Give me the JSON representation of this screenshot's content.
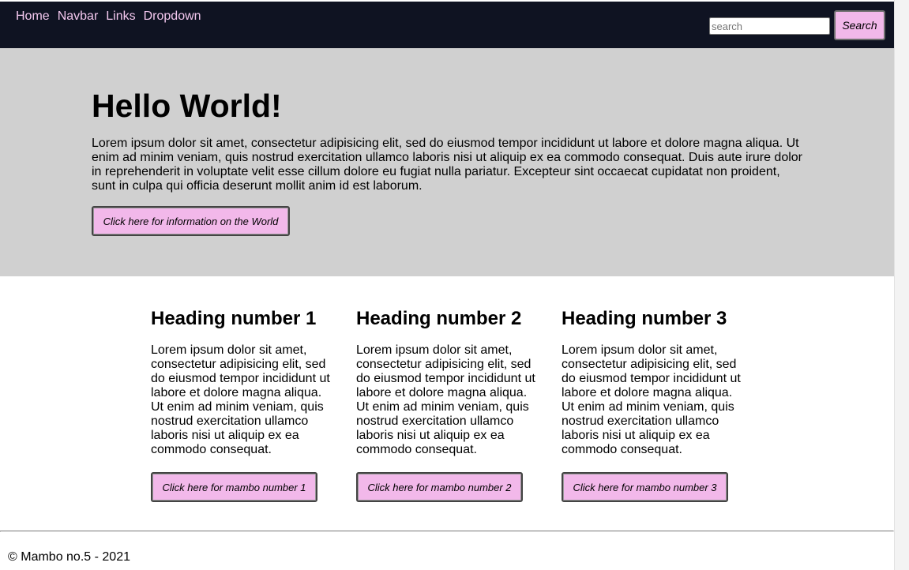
{
  "navbar": {
    "links": [
      "Home",
      "Navbar",
      "Links",
      "Dropdown"
    ],
    "search_placeholder": "search",
    "search_button": "Search",
    "background": "#0f1322",
    "link_color": "#f4c8ef"
  },
  "hero": {
    "title": "Hello World!",
    "text": "Lorem ipsum dolor sit amet, consectetur adipisicing elit, sed do eiusmod tempor incididunt ut labore et dolore magna aliqua. Ut enim ad minim veniam, quis nostrud exercitation ullamco laboris nisi ut aliquip ex ea commodo consequat. Duis aute irure dolor in reprehenderit in voluptate velit esse cillum dolore eu fugiat nulla pariatur. Excepteur sint occaecat cupidatat non proident, sunt in culpa qui officia deserunt mollit anim id est laborum.",
    "button": "Click here for information on the World",
    "background": "#d0d0d0"
  },
  "columns": [
    {
      "heading": "Heading number 1",
      "text": "Lorem ipsum dolor sit amet, consectetur adipisicing elit, sed do eiusmod tempor incididunt ut labore et dolore magna aliqua. Ut enim ad minim veniam, quis nostrud exercitation ullamco laboris nisi ut aliquip ex ea commodo consequat.",
      "button": "Click here for mambo number 1"
    },
    {
      "heading": "Heading number 2",
      "text": "Lorem ipsum dolor sit amet, consectetur adipisicing elit, sed do eiusmod tempor incididunt ut labore et dolore magna aliqua. Ut enim ad minim veniam, quis nostrud exercitation ullamco laboris nisi ut aliquip ex ea commodo consequat.",
      "button": "Click here for mambo number 2"
    },
    {
      "heading": "Heading number 3",
      "text": "Lorem ipsum dolor sit amet, consectetur adipisicing elit, sed do eiusmod tempor incididunt ut labore et dolore magna aliqua. Ut enim ad minim veniam, quis nostrud exercitation ullamco laboris nisi ut aliquip ex ea commodo consequat.",
      "button": "Click here for mambo number 3"
    }
  ],
  "footer": {
    "text": "© Mambo no.5 - 2021"
  },
  "colors": {
    "button_background": "#f2b8ea"
  }
}
